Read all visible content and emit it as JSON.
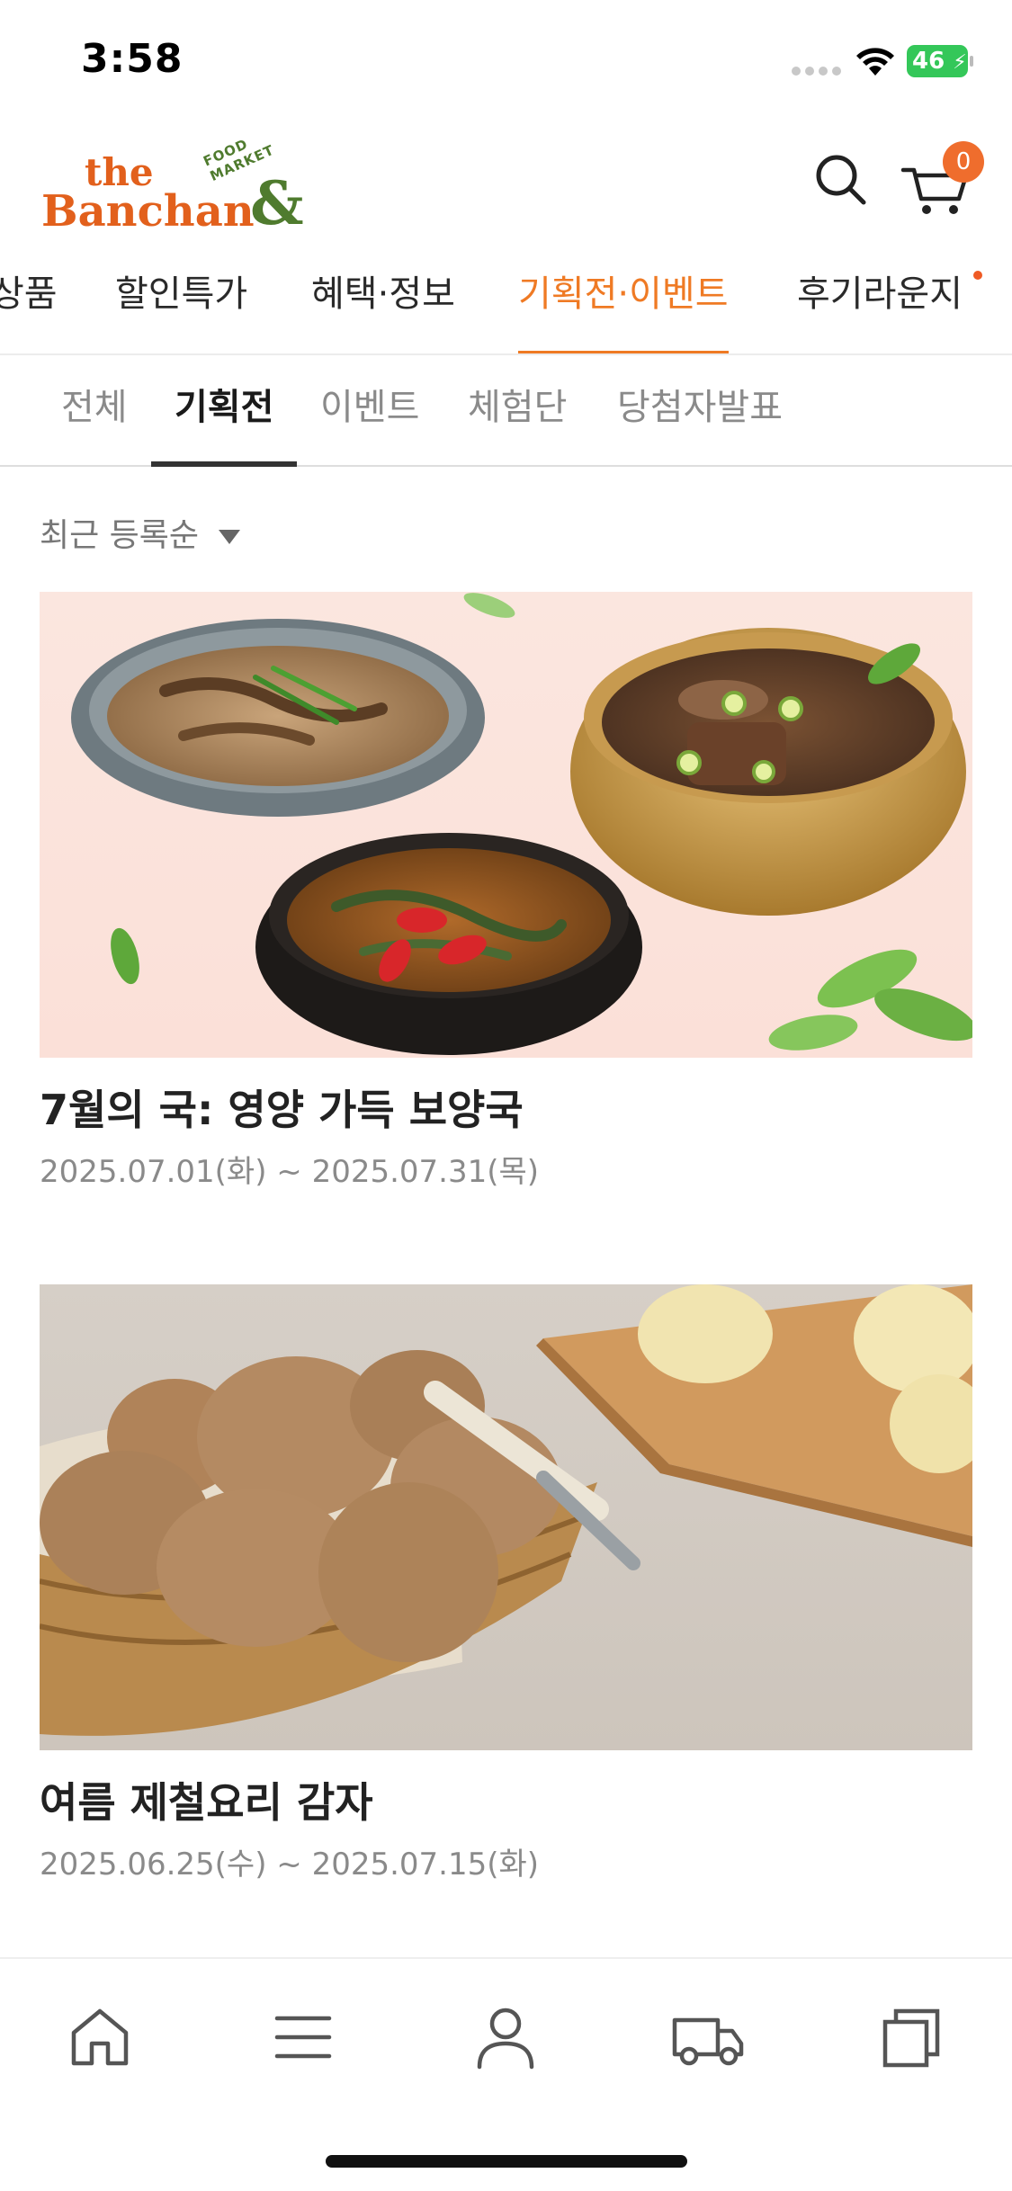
{
  "status_bar": {
    "time": "3:58",
    "battery": "46"
  },
  "header": {
    "logo": {
      "the": "the",
      "banchan": "Banchan",
      "amp": "&",
      "market": "FOOD MARKET"
    },
    "search_icon": "search-icon",
    "cart_icon": "cart-icon",
    "cart_count": "0"
  },
  "main_tabs": [
    {
      "label": "상품"
    },
    {
      "label": "할인특가"
    },
    {
      "label": "혜택·정보"
    },
    {
      "label": "기획전·이벤트",
      "active": true
    },
    {
      "label": "후기라운지",
      "new": true
    }
  ],
  "sub_tabs": [
    {
      "label": "전체"
    },
    {
      "label": "기획전",
      "active": true
    },
    {
      "label": "이벤트"
    },
    {
      "label": "체험단"
    },
    {
      "label": "당첨자발표"
    }
  ],
  "sort": {
    "label": "최근 등록순"
  },
  "cards": [
    {
      "title": "7월의 국: 영양 가득 보양국",
      "date": "2025.07.01(화) ~ 2025.07.31(목)"
    },
    {
      "title": "여름 제철요리 감자",
      "date": "2025.06.25(수) ~ 2025.07.15(화)"
    }
  ],
  "bottom_nav": [
    {
      "icon": "home-icon"
    },
    {
      "icon": "menu-icon"
    },
    {
      "icon": "user-icon"
    },
    {
      "icon": "delivery-truck-icon"
    },
    {
      "icon": "recent-items-icon"
    }
  ],
  "colors": {
    "accent": "#ef7a24",
    "brand_orange": "#e2601c",
    "brand_green": "#4f7b2e",
    "battery_green": "#34c759"
  }
}
